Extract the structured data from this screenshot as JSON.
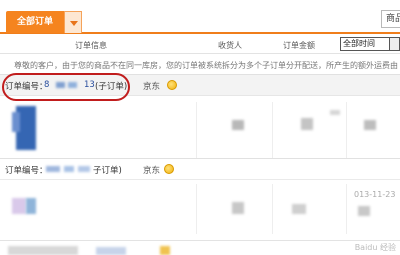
{
  "tabs": {
    "active_label": "全部订单"
  },
  "search": {
    "value": "商品"
  },
  "table_header": {
    "order_info": "订单信息",
    "receiver": "收货人",
    "amount": "订单金额",
    "time_filter": "全部时间"
  },
  "notice": "尊敬的客户，由于您的商品不在同一库房，您的订单被系统拆分为多个子订单分开配送，所产生的额外运费由",
  "orders": [
    {
      "label": "订单编号：",
      "number_start": "8",
      "number_end": "13",
      "suborder_tag": "(子订单)",
      "shop": "京东"
    },
    {
      "label": "订单编号：",
      "suborder_tag": "子订单)",
      "shop": "京东"
    }
  ],
  "second_order_date": "013-11-23",
  "watermark": "Baidu 经验"
}
